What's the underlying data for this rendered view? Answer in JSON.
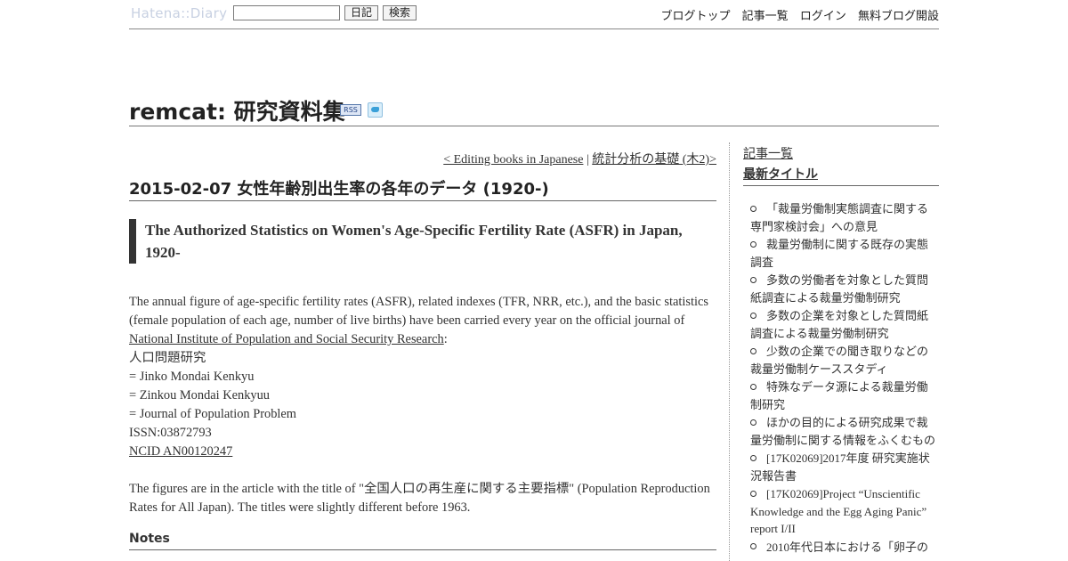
{
  "topbar": {
    "logo": "Hatena::Diary",
    "search_value": "",
    "diary_button": "日記",
    "search_button": "検索",
    "links": [
      "ブログトップ",
      "記事一覧",
      "ログイン",
      "無料ブログ開設"
    ]
  },
  "header": {
    "title": "remcat: 研究資料集",
    "rss": "RSS"
  },
  "nav": {
    "prev": "< Editing books in Japanese",
    "separator": "|",
    "next": " 統計分析の基礎 (木2)>"
  },
  "entry": {
    "day_title": "2015-02-07 女性年齢別出生率の各年のデータ (1920-)",
    "section_title": "The Authorized Statistics on Women's Age-Specific Fertility Rate (ASFR) in Japan, 1920-",
    "para1": "The annual figure of age-specific fertility rates (ASFR), related indexes (TFR, NRR, etc.), and the basic statistics (female population of each age, number of live births) have been carried every year on the official journal of",
    "ipss_link": "National Institute of Population and Social Security Research",
    "colon": ":",
    "journal_lines": [
      "人口問題研究",
      "= Jinko Mondai Kenkyu",
      "= Zinkou Mondai Kenkyuu",
      "= Journal of Population Problem",
      "ISSN:03872793"
    ],
    "ncid_link": "NCID AN00120247",
    "para2": "The figures are in the article with the title of \"全国人口の再生産に関する主要指標\" (Population Reproduction Rates for All Japan). The titles were slightly different before 1963.",
    "notes_title": "Notes"
  },
  "sidebar": {
    "list_link": "記事一覧",
    "recent_heading": "最新タイトル",
    "items": [
      "「裁量労働制実態調査に関する専門家検討会」への意見",
      "裁量労働制に関する既存の実態調査",
      "多数の労働者を対象とした質問紙調査による裁量労働制研究",
      "多数の企業を対象とした質問紙調査による裁量労働制研究",
      "少数の企業での聞き取りなどの裁量労働制ケーススタディ",
      "特殊なデータ源による裁量労働制研究",
      "ほかの目的による研究成果で裁量労働制に関する情報をふくむもの",
      "[17K02069]2017年度 研究実施状況報告書",
      "[17K02069]Project “Unscientific Knowledge and the Egg Aging Panic” report I/II",
      "2010年代日本における「卵子の"
    ]
  }
}
